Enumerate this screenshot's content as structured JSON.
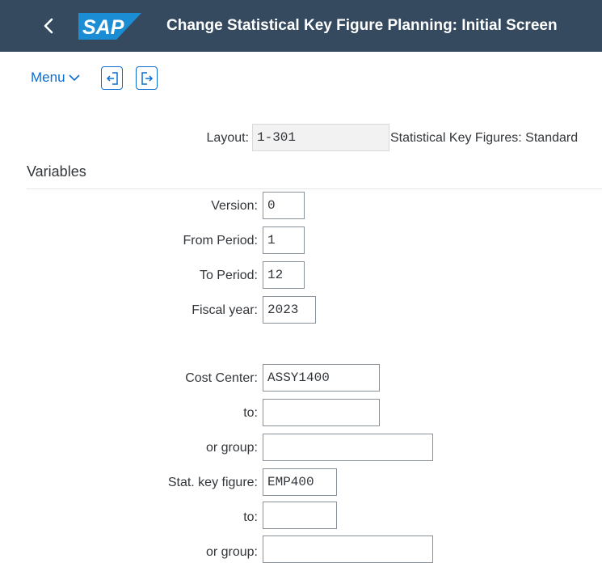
{
  "header": {
    "logo_text": "SAP",
    "title": "Change Statistical Key Figure Planning: Initial Screen",
    "back_icon": "chevron-left-icon"
  },
  "toolbar": {
    "menu_label": "Menu",
    "menu_icon": "chevron-down-icon",
    "icon_buttons": [
      "exit-icon",
      "export-icon"
    ]
  },
  "layout": {
    "label": "Layout:",
    "value": "1-301",
    "description": "Statistical Key Figures: Standard"
  },
  "variables": {
    "section_title": "Variables",
    "version": {
      "label": "Version:",
      "value": "0"
    },
    "from_period": {
      "label": "From Period:",
      "value": "1"
    },
    "to_period": {
      "label": "To Period:",
      "value": "12"
    },
    "fiscal_year": {
      "label": "Fiscal year:",
      "value": "2023"
    },
    "cost_center": {
      "label": "Cost Center:",
      "value": "ASSY1400"
    },
    "cost_center_to": {
      "label": "to:",
      "value": ""
    },
    "cost_center_group": {
      "label": "or group:",
      "value": ""
    },
    "stat_key_figure": {
      "label": "Stat. key figure:",
      "value": "EMP400"
    },
    "skf_to": {
      "label": "to:",
      "value": ""
    },
    "skf_group": {
      "label": "or group:",
      "value": ""
    }
  },
  "colors": {
    "shell_bg": "#354a5f",
    "accent": "#0a6ed1",
    "logo_bg": "#1b8dd5"
  }
}
